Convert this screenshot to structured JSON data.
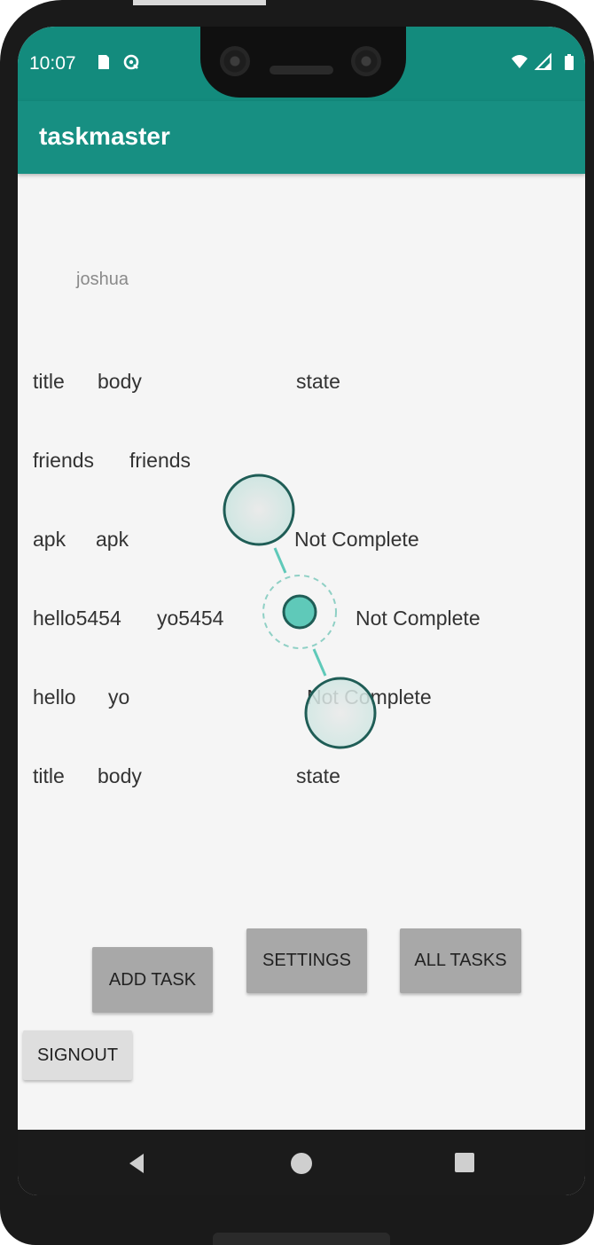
{
  "status_bar": {
    "time": "10:07",
    "icons": [
      "sd-card-icon",
      "sync-icon",
      "wifi-icon",
      "signal-icon",
      "battery-icon"
    ]
  },
  "app_bar": {
    "title": "taskmaster"
  },
  "user": {
    "name": "joshua"
  },
  "tasks": [
    {
      "title": "title",
      "body": "body",
      "state": "state"
    },
    {
      "title": "friends",
      "body": "friends",
      "state": ""
    },
    {
      "title": "apk",
      "body": "apk",
      "state": "Not Complete"
    },
    {
      "title": "hello5454",
      "body": "yo5454",
      "state": "Not Complete"
    },
    {
      "title": "hello",
      "body": "yo",
      "state": "Not Complete"
    },
    {
      "title": "title",
      "body": "body",
      "state": "state"
    }
  ],
  "buttons": {
    "add_task": "ADD TASK",
    "settings": "SETTINGS",
    "all_tasks": "ALL TASKS",
    "signout": "SIGNOUT"
  },
  "nav": {
    "icons": [
      "back-icon",
      "home-icon",
      "recents-icon"
    ]
  },
  "colors": {
    "primary": "#178f82",
    "status_bar": "#138b7d",
    "background": "#f5f5f5",
    "button": "#a8a8a8",
    "touch_indicator": "#5fc9b9"
  }
}
